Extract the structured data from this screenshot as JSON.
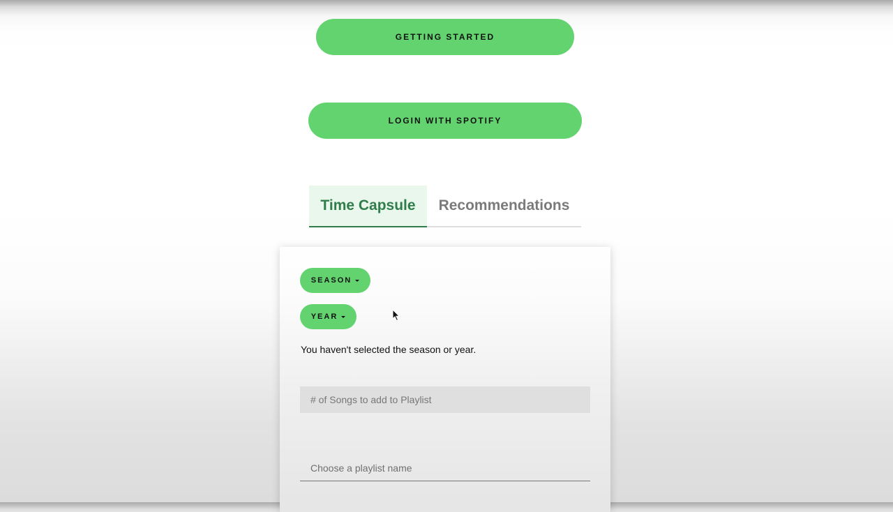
{
  "header": {
    "getting_started_label": "GETTING STARTED",
    "login_label": "LOGIN WITH SPOTIFY"
  },
  "tabs": [
    {
      "label": "Time Capsule",
      "active": true
    },
    {
      "label": "Recommendations",
      "active": false
    }
  ],
  "form": {
    "season_label": "SEASON",
    "year_label": "YEAR",
    "status_message": "You haven't selected the season or year.",
    "songs_placeholder": "# of Songs to add to Playlist",
    "playlist_placeholder": "Choose a playlist name"
  },
  "colors": {
    "accent_green": "#62d36f",
    "active_tab_text": "#2f7d4a",
    "active_tab_bg": "#eaf7ec",
    "inactive_tab_text": "#7a7a7a"
  },
  "icons": {
    "dropdown": "caret-down-icon",
    "pointer": "mouse-cursor-icon"
  }
}
